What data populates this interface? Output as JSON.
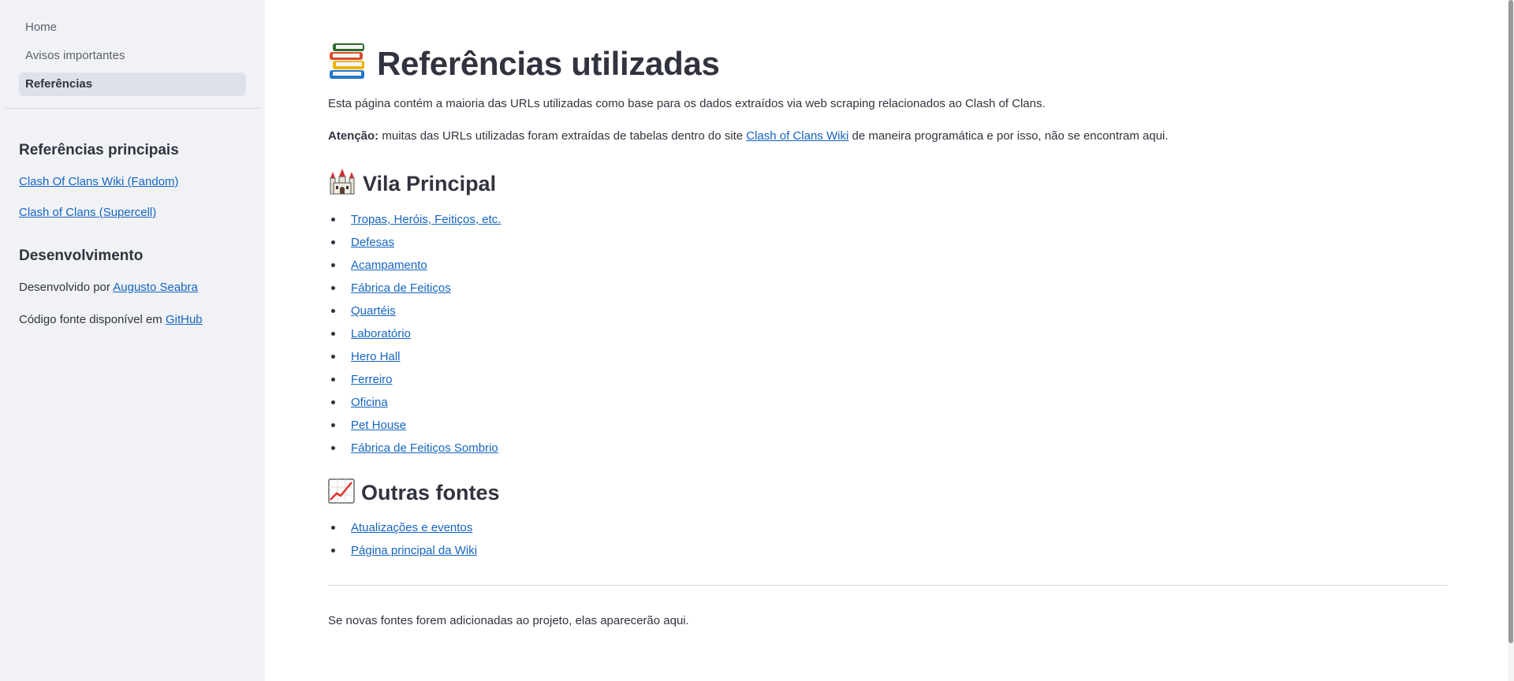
{
  "sidebar": {
    "nav": [
      {
        "label": "Home",
        "active": false
      },
      {
        "label": "Avisos importantes",
        "active": false
      },
      {
        "label": "Referências",
        "active": true
      }
    ],
    "section1_title": "Referências principais",
    "links": [
      "Clash Of Clans Wiki (Fandom)",
      "Clash of Clans (Supercell)"
    ],
    "section2_title": "Desenvolvimento",
    "dev_prefix": "Desenvolvido por ",
    "dev_name": "Augusto Seabra",
    "source_prefix": "Código fonte disponível em ",
    "source_link": "GitHub"
  },
  "main": {
    "title_icon": "books-icon",
    "title": "Referências utilizadas",
    "intro": "Esta página contém a maioria das URLs utilizadas como base para os dados extraídos via web scraping relacionados ao Clash of Clans.",
    "attention_label": "Atenção:",
    "attention_text_1": " muitas das URLs utilizadas foram extraídas de tabelas dentro do site ",
    "attention_link": "Clash of Clans Wiki",
    "attention_text_2": " de maneira programática e por isso, não se encontram aqui.",
    "village_icon": "castle-icon",
    "village_title": "Vila Principal",
    "village_links": [
      "Tropas, Heróis, Feitiços, etc.",
      "Defesas",
      "Acampamento",
      "Fábrica de Feitiços",
      "Quartéis",
      "Laboratório",
      "Hero Hall",
      "Ferreiro",
      "Oficina",
      "Pet House",
      "Fábrica de Feitiços Sombrio"
    ],
    "other_icon": "chart-increasing-icon",
    "other_title": "Outras fontes",
    "other_links": [
      "Atualizações e eventos",
      "Página principal da Wiki"
    ],
    "footer_note": "Se novas fontes forem adicionadas ao projeto, elas aparecerão aqui."
  }
}
